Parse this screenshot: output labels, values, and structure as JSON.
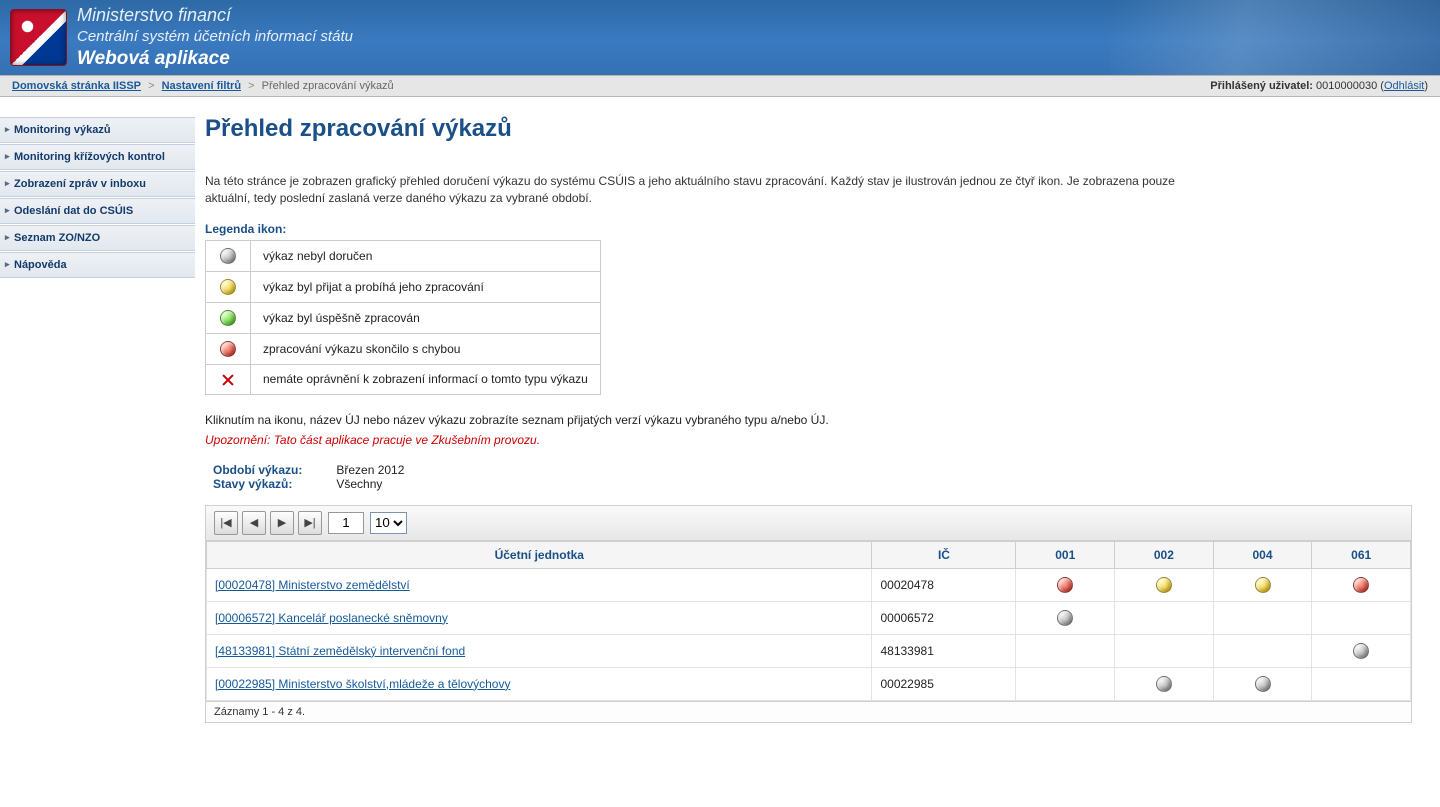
{
  "header": {
    "line1": "Ministerstvo financí",
    "line2": "Centrální systém účetních informací státu",
    "line3": "Webová aplikace"
  },
  "breadcrumb": {
    "home": "Domovská stránka IISSP",
    "filters": "Nastavení filtrů",
    "current": "Přehled zpracování výkazů"
  },
  "userbar": {
    "logged_label": "Přihlášený uživatel:",
    "user": "0010000030",
    "logout": "Odhlásit"
  },
  "sidebar": {
    "items": [
      "Monitoring výkazů",
      "Monitoring křížových kontrol",
      "Zobrazení zpráv v inboxu",
      "Odeslání dat do CSÚIS",
      "Seznam ZO/NZO",
      "Nápověda"
    ]
  },
  "page": {
    "title": "Přehled zpracování výkazů",
    "intro": "Na této stránce je zobrazen grafický přehled doručení výkazu do systému CSÚIS a jeho aktuálního stavu zpracování. Každý stav je ilustrován jednou ze čtyř ikon. Je zobrazena pouze aktuální, tedy poslední zaslaná verze daného výkazu za vybrané období.",
    "legend_title": "Legenda ikon:",
    "legend": [
      {
        "icon": "grey",
        "text": "výkaz nebyl doručen"
      },
      {
        "icon": "yellow",
        "text": "výkaz byl přijat a probíhá jeho zpracování"
      },
      {
        "icon": "green",
        "text": "výkaz byl úspěšně zpracován"
      },
      {
        "icon": "red",
        "text": "zpracování výkazu skončilo s chybou"
      },
      {
        "icon": "noperm",
        "text": "nemáte oprávnění k zobrazení informací o tomto typu výkazu"
      }
    ],
    "hint": "Kliknutím na ikonu, název ÚJ nebo název výkazu zobrazíte seznam přijatých verzí výkazu vybraného typu a/nebo ÚJ.",
    "warning": "Upozornění: Tato část aplikace pracuje ve Zkušebním provozu.",
    "filters": {
      "period_label": "Období výkazu:",
      "period_value": "Březen 2012",
      "states_label": "Stavy výkazů:",
      "states_value": "Všechny"
    }
  },
  "grid": {
    "toolbar": {
      "page": "1",
      "pagesize": "10"
    },
    "headers": {
      "unit": "Účetní jednotka",
      "ic": "IČ",
      "c001": "001",
      "c002": "002",
      "c004": "004",
      "c061": "061"
    },
    "rows": [
      {
        "link": "[00020478] Ministerstvo zemědělství",
        "ic": "00020478",
        "c001": "red",
        "c002": "yellow",
        "c004": "yellow",
        "c061": "red"
      },
      {
        "link": "[00006572] Kancelář poslanecké sněmovny",
        "ic": "00006572",
        "c001": "grey",
        "c002": "",
        "c004": "",
        "c061": ""
      },
      {
        "link": "[48133981] Státní zemědělský intervenční fond",
        "ic": "48133981",
        "c001": "",
        "c002": "",
        "c004": "",
        "c061": "grey"
      },
      {
        "link": "[00022985] Ministerstvo školství,mládeže a tělovýchovy",
        "ic": "00022985",
        "c001": "",
        "c002": "grey",
        "c004": "grey",
        "c061": ""
      }
    ],
    "footer": "Záznamy 1 - 4 z 4."
  }
}
